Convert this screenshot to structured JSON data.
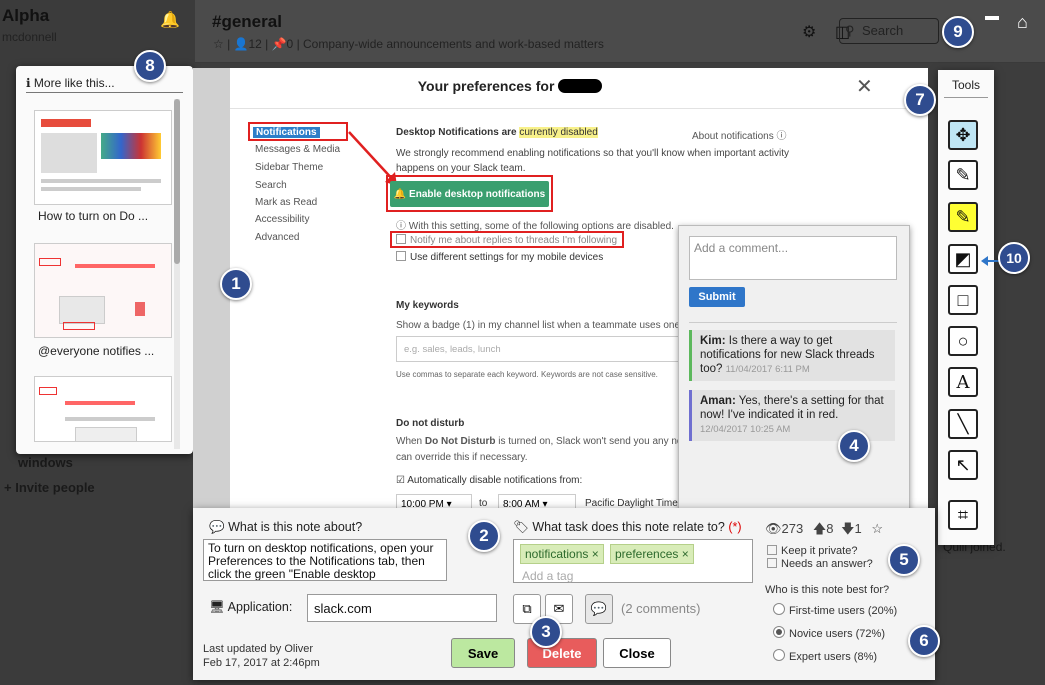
{
  "background_app": {
    "workspace": "Alpha",
    "workspace_sub": "mcdonnell",
    "channel": "#general",
    "channel_meta": "☆ | 👤12 | 📌0 | Company-wide announcements and work-based matters",
    "search_placeholder": "Search",
    "sidebar_fragments": [
      "windows",
      "+ Invite people"
    ],
    "joined_fragment": "Quill joined."
  },
  "badges": [
    "1",
    "2",
    "3",
    "4",
    "5",
    "6",
    "7",
    "8",
    "9",
    "10"
  ],
  "more_like_this": {
    "title": "More like this...",
    "items": [
      {
        "caption": "How to turn on Do ..."
      },
      {
        "caption": "@everyone notifies ..."
      },
      {
        "caption": ""
      }
    ]
  },
  "preferences": {
    "title": "Your preferences for",
    "nav": [
      "Notifications",
      "Messages & Media",
      "Sidebar Theme",
      "Search",
      "Mark as Read",
      "Accessibility",
      "Advanced"
    ],
    "desktop_heading": "Desktop Notifications are",
    "desktop_highlight": "currently disabled",
    "about_link": "About notifications ⓘ",
    "recommend_text": "We strongly recommend enabling notifications so that you'll know when important activity happens on your Slack team.",
    "enable_button": "🔔 Enable desktop notifications",
    "with_setting": "ⓘ With this setting, some of the following options are disabled.",
    "notify_threads": "Notify me about replies to threads I'm following",
    "mobile_settings": "Use different settings for my mobile devices",
    "keywords_heading": "My keywords",
    "keywords_desc": "Show a badge (1) in my channel list when a teammate uses one",
    "keywords_placeholder": "e.g. sales, leads, lunch",
    "keywords_hint": "Use commas to separate each keyword. Keywords are not case sensitive.",
    "dnd_heading": "Do not disturb",
    "dnd_desc_a": "When",
    "dnd_desc_bold": "Do Not Disturb",
    "dnd_desc_b": "is turned on, Slack won't send you any not",
    "dnd_desc_c": "can override this if necessary.",
    "auto_disable": "Automatically disable notifications from:",
    "from_time": "10:00 PM",
    "to_label": "to",
    "to_time": "8:00 AM",
    "timezone": "Pacific Daylight Time"
  },
  "comments_panel": {
    "placeholder": "Add a comment...",
    "submit": "Submit",
    "comments": [
      {
        "author": "Kim:",
        "text": "Is there a way to get notifications for new Slack threads too?",
        "time": "11/04/2017 6:11 PM",
        "color": "#5cb85c"
      },
      {
        "author": "Aman:",
        "text": "Yes, there's a setting for that now! I've indicated it in red.",
        "time": "12/04/2017 10:25 AM",
        "color": "#6f6fd0"
      }
    ]
  },
  "tools": {
    "title": "Tools",
    "items": [
      {
        "name": "move-tool",
        "glyph": "✥"
      },
      {
        "name": "pen-tool",
        "glyph": "✎"
      },
      {
        "name": "highlighter-tool",
        "glyph": "✎"
      },
      {
        "name": "eraser-tool",
        "glyph": "◩"
      },
      {
        "name": "rectangle-tool",
        "glyph": "□"
      },
      {
        "name": "circle-tool",
        "glyph": "○"
      },
      {
        "name": "text-tool",
        "glyph": "A"
      },
      {
        "name": "line-tool",
        "glyph": "╲"
      },
      {
        "name": "arrow-tool",
        "glyph": "↖"
      },
      {
        "name": "crop-tool",
        "glyph": "⌗"
      }
    ]
  },
  "editor": {
    "about_label": "What is this note about?",
    "note_text": "To turn on desktop notifications, open your Preferences to the Notifications tab, then click the green \"Enable desktop notifications\" button.",
    "task_label": "What task does this note relate to?",
    "required": "(*)",
    "tags": [
      "notifications ×",
      "preferences ×"
    ],
    "tag_placeholder": "Add a tag",
    "views": "273",
    "upvotes": "8",
    "downvotes": "1",
    "keep_private": "Keep it private?",
    "needs_answer": "Needs an answer?",
    "application_label": "Application:",
    "application_value": "slack.com",
    "comment_count": "(2 comments)",
    "best_for_label": "Who is this note best for?",
    "audiences": [
      {
        "label": "First-time users (20%)",
        "selected": false
      },
      {
        "label": "Novice users (72%)",
        "selected": true
      },
      {
        "label": "Expert users (8%)",
        "selected": false
      }
    ],
    "last_updated": "Last updated by Oliver",
    "last_updated_date": "Feb 17, 2017 at 2:46pm",
    "save": "Save",
    "delete": "Delete",
    "close": "Close"
  }
}
